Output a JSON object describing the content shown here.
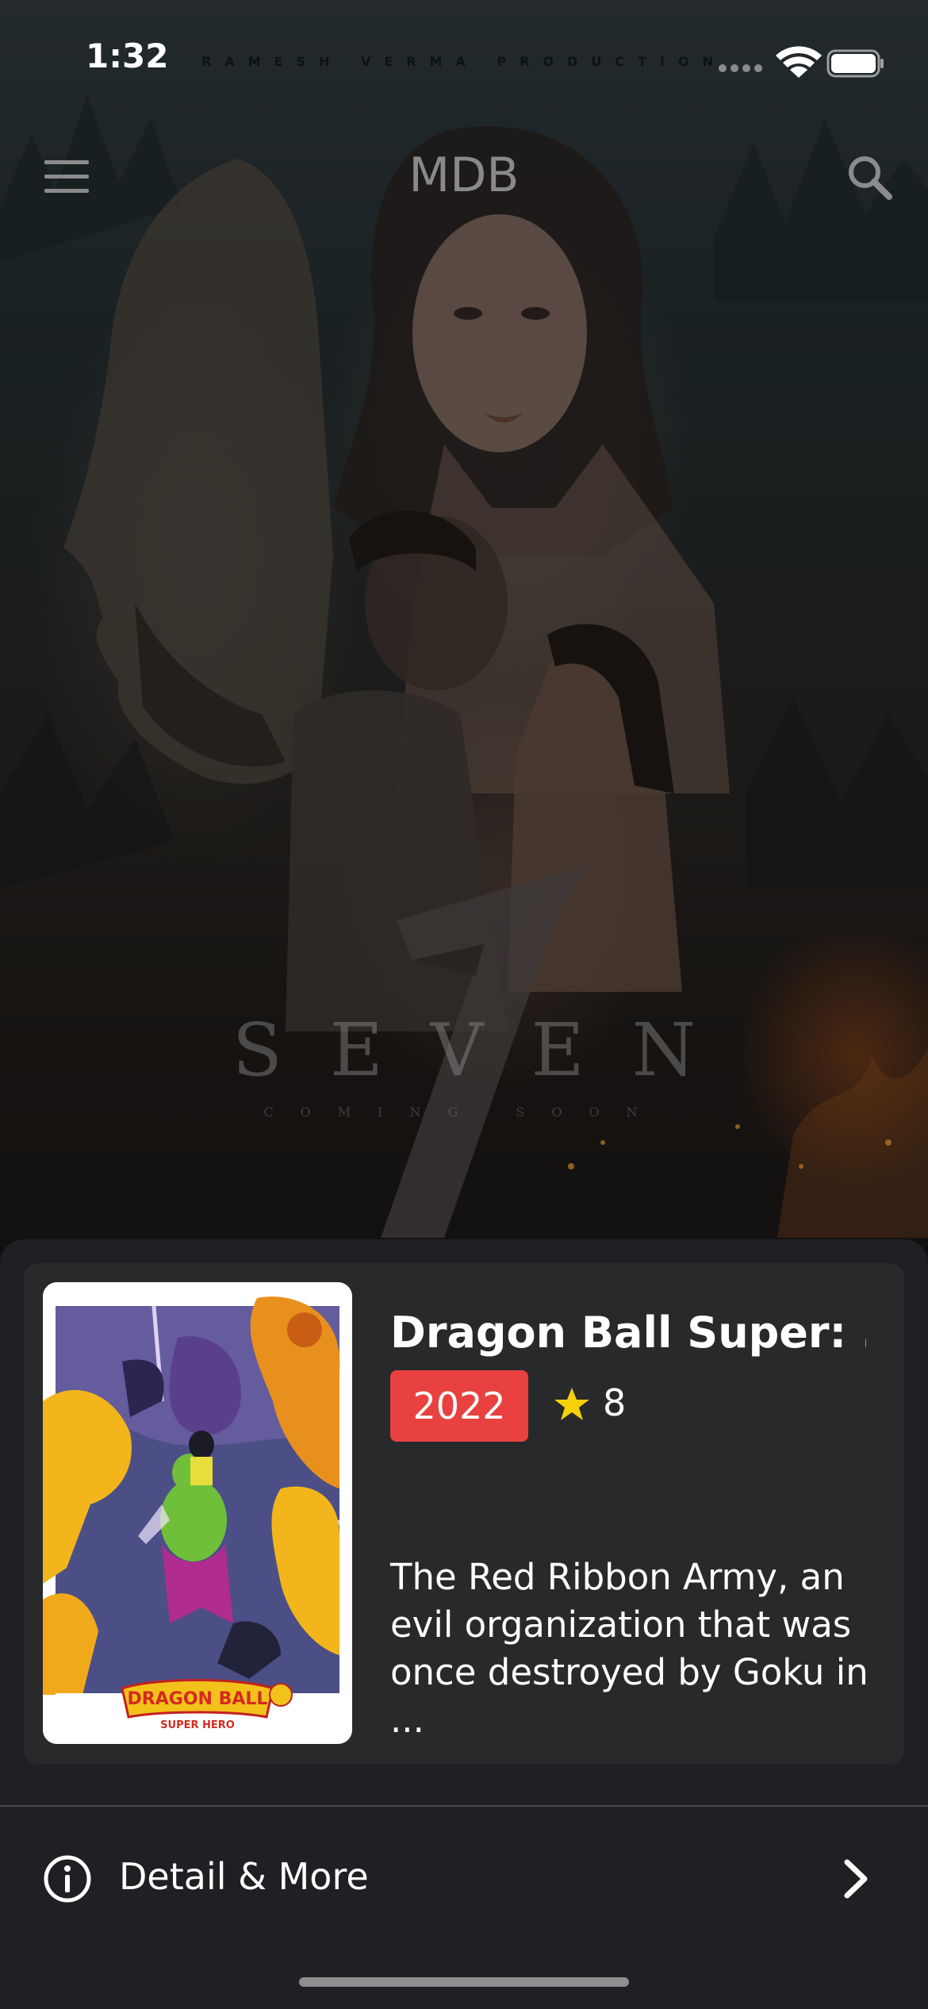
{
  "status_bar": {
    "time": "1:32",
    "icons": [
      "signal-dots-icon",
      "wifi-icon",
      "battery-icon"
    ]
  },
  "nav": {
    "title": "MDB",
    "menu_icon": "hamburger-menu-icon",
    "search_icon": "search-icon"
  },
  "hero": {
    "credit": "RAMESH VERMA PRODUCTION",
    "title": "SEVEN",
    "subtitle": "COMING SOON",
    "numeral": "7"
  },
  "movie": {
    "title": "Dragon Ball Super: ...",
    "year": "2022",
    "rating": "8",
    "overview": "The Red Ribbon Army, an evil organization that was once destroyed by Goku in ...",
    "poster": {
      "logo_main": "DRAGON BALL",
      "logo_sub": "SUPER HERO"
    }
  },
  "footer": {
    "detail_label": "Detail & More",
    "info_icon": "info-icon",
    "chevron_icon": "chevron-right-icon"
  },
  "colors": {
    "badge": "#e8413f",
    "star": "#f5d10c",
    "background": "#1e2024",
    "card": "#28292b"
  }
}
